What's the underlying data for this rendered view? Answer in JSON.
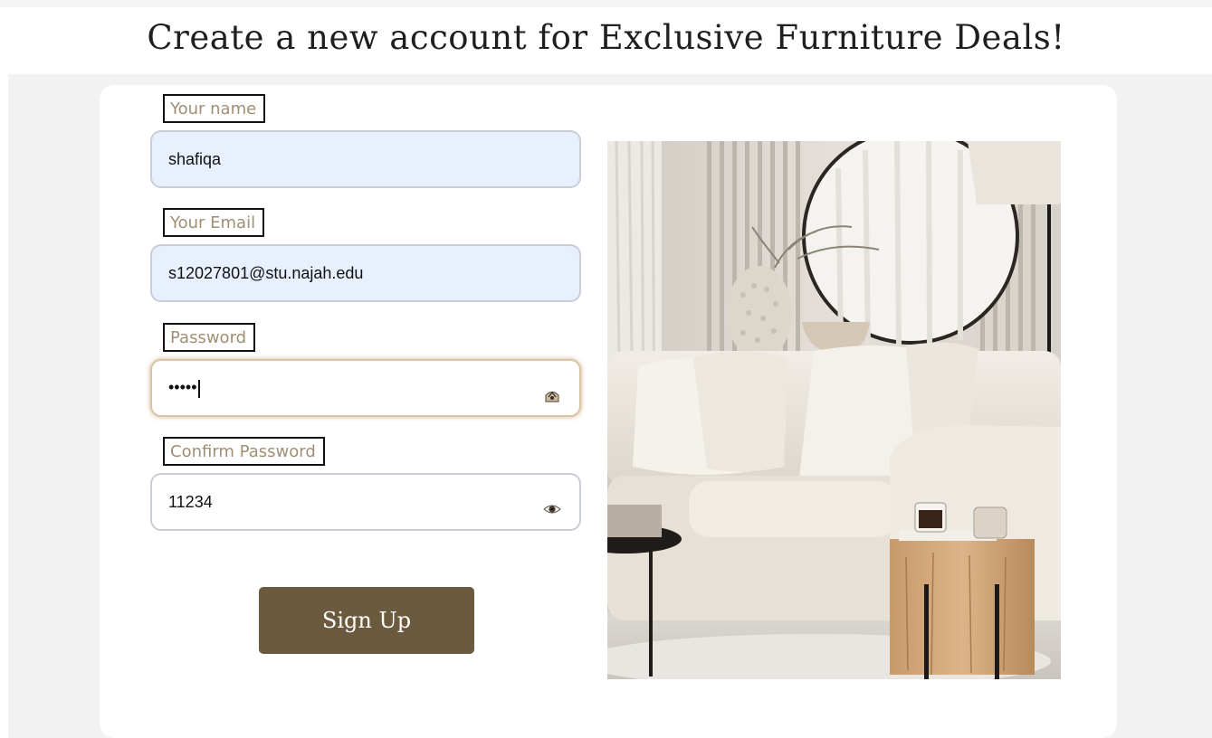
{
  "page": {
    "title": "Create a new account for Exclusive Furniture Deals!"
  },
  "form": {
    "name": {
      "label": "Your name",
      "value": "shafiqa"
    },
    "email": {
      "label": "Your Email",
      "value": "s12027801@stu.najah.edu"
    },
    "password": {
      "label": "Password",
      "value": "•••••",
      "toggle_icon": "hidden-eye-icon"
    },
    "confirm_password": {
      "label": "Confirm Password",
      "value": "11234",
      "toggle_icon": "eye-icon"
    },
    "submit_label": "Sign Up"
  },
  "colors": {
    "accent": "#6b5a3e",
    "label_text": "#a08e74",
    "autofill_bg": "#e8f0fe",
    "page_bg": "#f2f2f2"
  },
  "image": {
    "subject": "living-room-sofa-photo"
  }
}
